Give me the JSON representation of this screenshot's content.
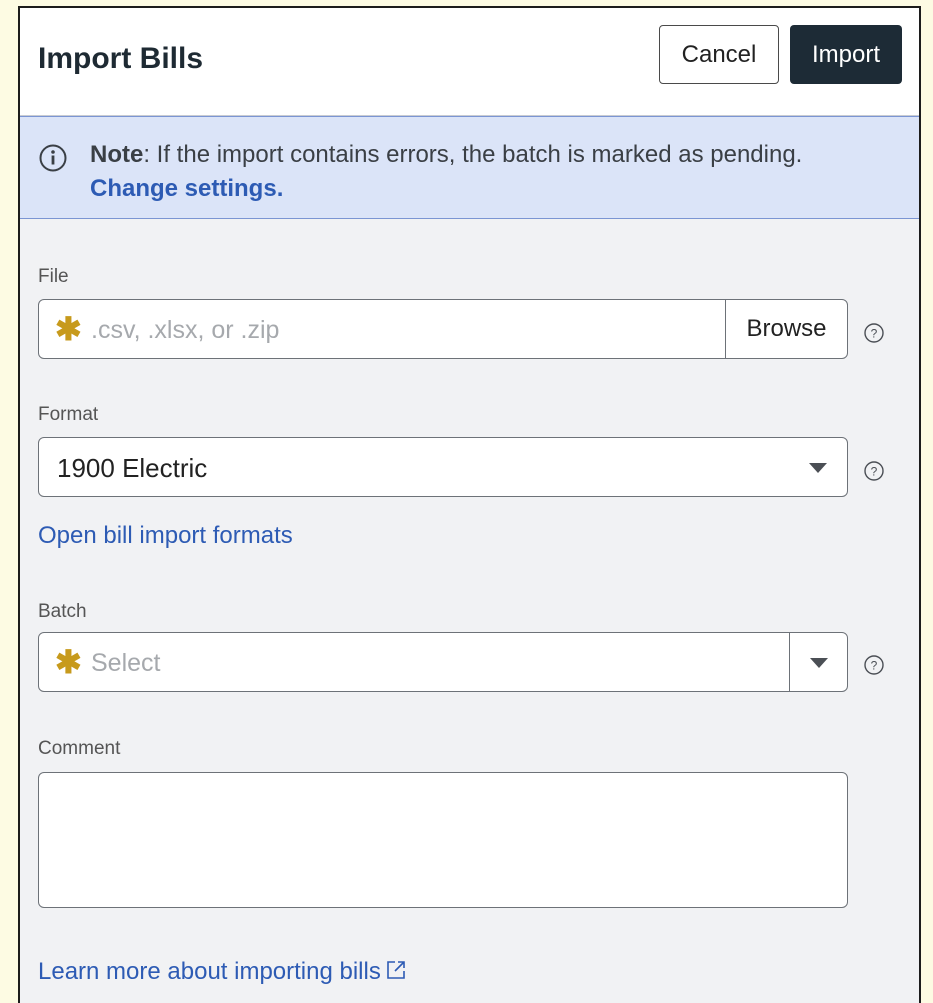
{
  "dialog": {
    "title": "Import Bills",
    "cancel_label": "Cancel",
    "import_label": "Import"
  },
  "banner": {
    "note_label": "Note",
    "message": ": If the import contains errors, the batch is marked as pending.",
    "link_label": "Change settings."
  },
  "file": {
    "label": "File",
    "placeholder": ".csv, .xlsx, or .zip",
    "browse_label": "Browse",
    "required": true
  },
  "format": {
    "label": "Format",
    "value": "1900 Electric",
    "link_label": "Open bill import formats"
  },
  "batch": {
    "label": "Batch",
    "placeholder": "Select",
    "required": true
  },
  "comment": {
    "label": "Comment",
    "value": ""
  },
  "footer": {
    "learn_more_label": "Learn more about importing bills"
  },
  "colors": {
    "accent": "#2d5bb4",
    "primary_button": "#1d2b36",
    "banner_bg": "#dbe4f8",
    "required_asterisk": "#c79a1c"
  }
}
